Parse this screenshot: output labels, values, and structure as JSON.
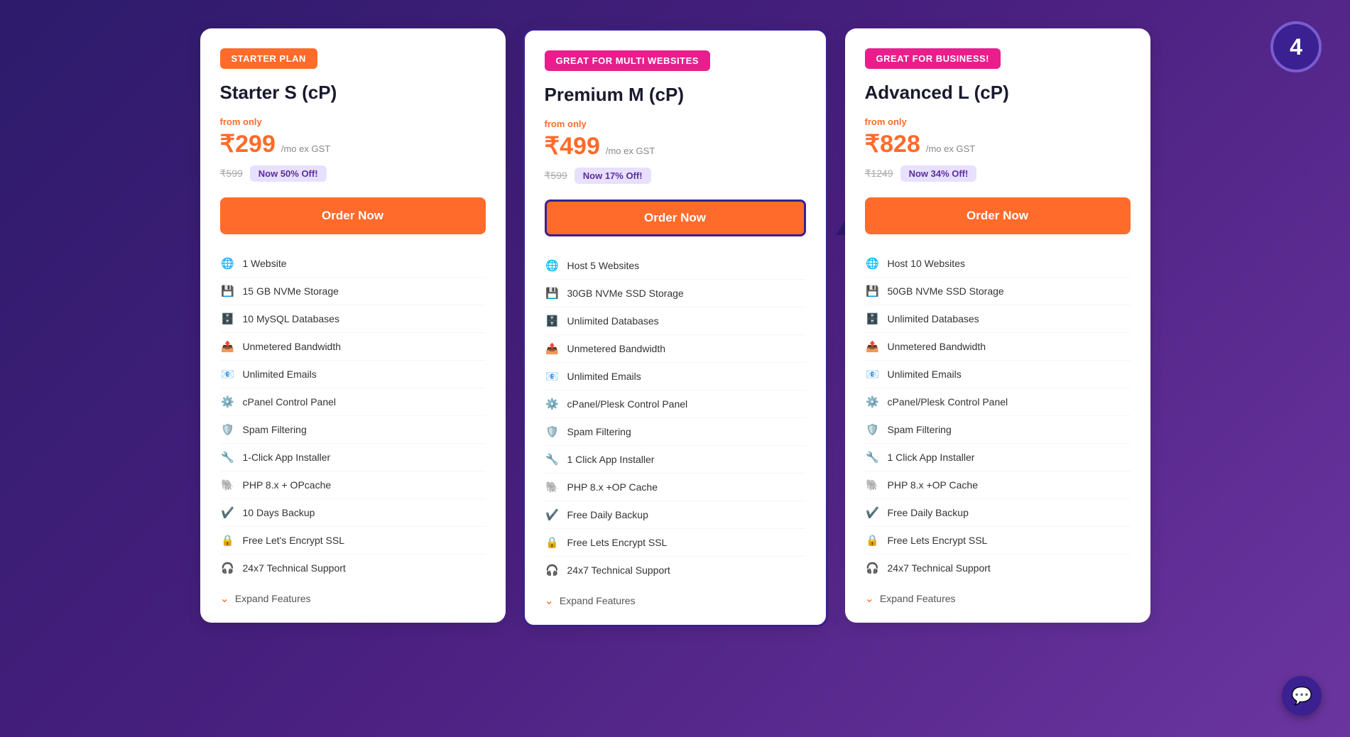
{
  "step": {
    "number": "4"
  },
  "plans": [
    {
      "id": "starter",
      "badge": "STARTER PLAN",
      "badge_class": "badge-orange",
      "name": "Starter S (cP)",
      "price_label": "from only",
      "price": "₹299",
      "period": "/mo ex GST",
      "original_price": "₹599",
      "discount": "Now 50% Off!",
      "order_btn": "Order Now",
      "featured": false,
      "features": [
        {
          "icon": "🌐",
          "text": "1 Website"
        },
        {
          "icon": "💾",
          "text": "15 GB NVMe Storage"
        },
        {
          "icon": "🗄️",
          "text": "10 MySQL Databases"
        },
        {
          "icon": "📤",
          "text": "Unmetered Bandwidth"
        },
        {
          "icon": "📧",
          "text": "Unlimited Emails"
        },
        {
          "icon": "⚙️",
          "text": "cPanel Control Panel"
        },
        {
          "icon": "🛡️",
          "text": "Spam Filtering"
        },
        {
          "icon": "🔧",
          "text": "1-Click App Installer"
        },
        {
          "icon": "🐘",
          "text": "PHP 8.x + OPcache"
        },
        {
          "icon": "✔️",
          "text": "10 Days Backup"
        },
        {
          "icon": "🔒",
          "text": "Free Let's Encrypt SSL"
        },
        {
          "icon": "🎧",
          "text": "24x7 Technical Support"
        }
      ],
      "expand": "Expand Features"
    },
    {
      "id": "premium",
      "badge": "GREAT FOR MULTI WEBSITES",
      "badge_class": "badge-magenta",
      "name": "Premium M (cP)",
      "price_label": "from only",
      "price": "₹499",
      "period": "/mo ex GST",
      "original_price": "₹599",
      "discount": "Now 17% Off!",
      "order_btn": "Order Now",
      "featured": true,
      "features": [
        {
          "icon": "🌐",
          "text": "Host 5 Websites"
        },
        {
          "icon": "💾",
          "text": "30GB NVMe SSD Storage"
        },
        {
          "icon": "🗄️",
          "text": "Unlimited Databases"
        },
        {
          "icon": "📤",
          "text": "Unmetered Bandwidth"
        },
        {
          "icon": "📧",
          "text": "Unlimited Emails"
        },
        {
          "icon": "⚙️",
          "text": "cPanel/Plesk Control Panel"
        },
        {
          "icon": "🛡️",
          "text": "Spam Filtering"
        },
        {
          "icon": "🔧",
          "text": "1 Click App Installer"
        },
        {
          "icon": "🐘",
          "text": "PHP 8.x +OP Cache"
        },
        {
          "icon": "✔️",
          "text": "Free Daily Backup"
        },
        {
          "icon": "🔒",
          "text": "Free Lets Encrypt SSL"
        },
        {
          "icon": "🎧",
          "text": "24x7 Technical Support"
        }
      ],
      "expand": "Expand Features"
    },
    {
      "id": "advanced",
      "badge": "GREAT FOR BUSINESS!",
      "badge_class": "badge-magenta",
      "name": "Advanced L (cP)",
      "price_label": "from only",
      "price": "₹828",
      "period": "/mo ex GST",
      "original_price": "₹1249",
      "discount": "Now 34% Off!",
      "order_btn": "Order Now",
      "featured": false,
      "features": [
        {
          "icon": "🌐",
          "text": "Host 10 Websites"
        },
        {
          "icon": "💾",
          "text": "50GB NVMe SSD Storage"
        },
        {
          "icon": "🗄️",
          "text": "Unlimited Databases"
        },
        {
          "icon": "📤",
          "text": "Unmetered Bandwidth"
        },
        {
          "icon": "📧",
          "text": "Unlimited Emails"
        },
        {
          "icon": "⚙️",
          "text": "cPanel/Plesk Control Panel"
        },
        {
          "icon": "🛡️",
          "text": "Spam Filtering"
        },
        {
          "icon": "🔧",
          "text": "1 Click App Installer"
        },
        {
          "icon": "🐘",
          "text": "PHP 8.x +OP Cache"
        },
        {
          "icon": "✔️",
          "text": "Free Daily Backup"
        },
        {
          "icon": "🔒",
          "text": "Free Lets Encrypt SSL"
        },
        {
          "icon": "🎧",
          "text": "24x7 Technical Support"
        }
      ],
      "expand": "Expand Features"
    }
  ],
  "chat": {
    "icon": "💬"
  }
}
